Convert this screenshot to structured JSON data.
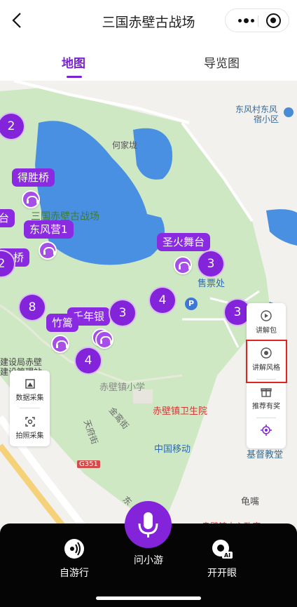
{
  "nav": {
    "title": "三国赤壁古战场",
    "back_icon": "chevron-left-icon",
    "more_icon": "more-dots-icon",
    "close_icon": "target-circle-icon"
  },
  "tabs": [
    {
      "label": "地图",
      "active": true
    },
    {
      "label": "导览图",
      "active": false
    }
  ],
  "map": {
    "place_labels": {
      "east_wind_village": "东风村东风",
      "east_wind_village_2": "宿小区",
      "hejialong": "何家垅",
      "park_name": "三国赤壁古战场",
      "ticket_office": "售票处",
      "town_school": "赤壁镇小学",
      "health_center": "赤壁镇卫生院",
      "china_mobile": "中国移动",
      "church": "基督教堂",
      "guizui": "龟嘴",
      "jinluan_street": "金鸾街",
      "tianfu_street": "天府街",
      "highway": "G351",
      "bureau_1": "建设局赤壁",
      "bureau_2": "建设管理站",
      "dong_road": "东",
      "partial_bottom": "赤壁镇中心政府"
    },
    "spots": [
      "得胜桥",
      "东风营1",
      "圣火舞台",
      "千年银",
      "竹篙",
      "小桥",
      "台"
    ],
    "clusters": [
      "2",
      "2",
      "3",
      "4",
      "3",
      "3",
      "8",
      "4"
    ],
    "parking": "P"
  },
  "left_tools": [
    {
      "label": "数据采集",
      "icon": "data-collect-icon"
    },
    {
      "label": "拍照采集",
      "icon": "photo-scan-icon"
    }
  ],
  "right_tools": [
    {
      "label": "讲解包",
      "icon": "audio-pack-icon"
    },
    {
      "label": "讲解风格",
      "icon": "narration-style-icon"
    },
    {
      "label": "推荐有奖",
      "icon": "gift-icon"
    },
    {
      "label": "",
      "icon": "locate-icon"
    }
  ],
  "bottom_bar": {
    "self_tour": "自游行",
    "ask": "问小游",
    "open_eye": "开开眼",
    "open_eye_badge": "AI"
  },
  "colors": {
    "accent": "#7b22d4",
    "cluster": "#8323da",
    "park_green": "#cfe8c4",
    "water": "#4a90e2",
    "highlight": "#e0241f"
  }
}
